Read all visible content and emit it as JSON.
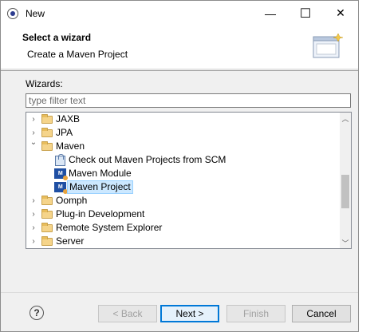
{
  "window": {
    "title": "New",
    "minimize_glyph": "—",
    "maximize_glyph": "☐",
    "close_glyph": "✕"
  },
  "header": {
    "title": "Select a wizard",
    "description": "Create a Maven Project"
  },
  "wizards": {
    "label": "Wizards:",
    "filter_placeholder": "type filter text",
    "filter_value": ""
  },
  "tree": {
    "items": [
      {
        "label": "JAXB",
        "level": 0,
        "expander": "›",
        "icon": "folder-icon"
      },
      {
        "label": "JPA",
        "level": 0,
        "expander": "›",
        "icon": "folder-icon"
      },
      {
        "label": "Maven",
        "level": 0,
        "expander": "⌄",
        "icon": "folder-open-icon"
      },
      {
        "label": "Check out Maven Projects from SCM",
        "level": 1,
        "expander": "",
        "icon": "scm-checkout-icon"
      },
      {
        "label": "Maven Module",
        "level": 1,
        "expander": "",
        "icon": "maven-module-icon"
      },
      {
        "label": "Maven Project",
        "level": 1,
        "expander": "",
        "icon": "maven-project-icon",
        "selected": true
      },
      {
        "label": "Oomph",
        "level": 0,
        "expander": "›",
        "icon": "folder-icon"
      },
      {
        "label": "Plug-in Development",
        "level": 0,
        "expander": "›",
        "icon": "folder-icon"
      },
      {
        "label": "Remote System Explorer",
        "level": 0,
        "expander": "›",
        "icon": "folder-icon"
      },
      {
        "label": "Server",
        "level": 0,
        "expander": "›",
        "icon": "folder-icon"
      }
    ],
    "scroll_up_glyph": "︿",
    "scroll_down_glyph": "﹀"
  },
  "buttons": {
    "help": "?",
    "back": "< Back",
    "next": "Next >",
    "finish": "Finish",
    "cancel": "Cancel"
  }
}
